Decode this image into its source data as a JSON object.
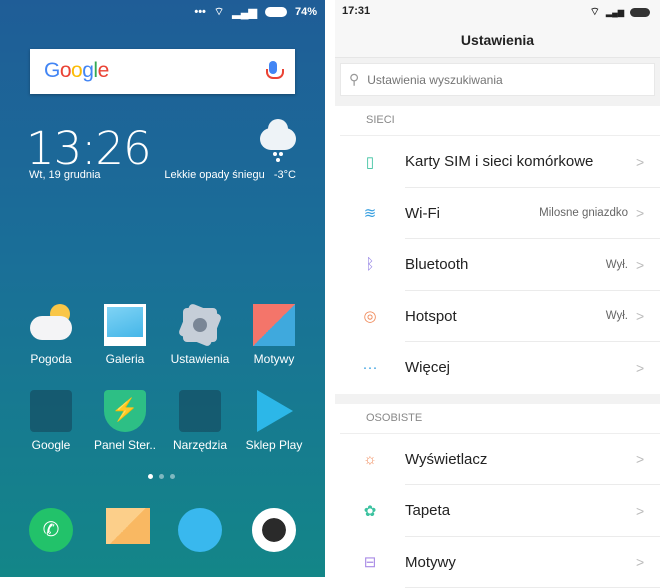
{
  "home": {
    "status": {
      "battery": "74%"
    },
    "search": {
      "logo": "Google",
      "mic_icon": "microphone-icon"
    },
    "clock": {
      "time": "13:26",
      "date": "Wt, 19 grudnia"
    },
    "weather": {
      "description": "Lekkie opady śniegu",
      "temperature": "-3°C",
      "icon": "snow-cloud-icon"
    },
    "apps": [
      {
        "label": "Pogoda"
      },
      {
        "label": "Galeria"
      },
      {
        "label": "Ustawienia"
      },
      {
        "label": "Motywy"
      },
      {
        "label": "Google"
      },
      {
        "label": "Panel Ster.."
      },
      {
        "label": "Narzędzia"
      },
      {
        "label": "Sklep Play"
      }
    ],
    "page_indicator": {
      "current": 1,
      "total": 3
    },
    "dock": [
      "phone-icon",
      "messages-icon",
      "browser-icon",
      "camera-icon"
    ]
  },
  "settings": {
    "status": {
      "time": "17:31"
    },
    "title": "Ustawienia",
    "search_placeholder": "Ustawienia wyszukiwania",
    "sections": [
      {
        "header": "SIECI",
        "items": [
          {
            "label": "Karty SIM i sieci komórkowe",
            "value": "",
            "icon": "sim-icon",
            "color": "#3cc2a0"
          },
          {
            "label": "Wi-Fi",
            "value": "Milosne gniazdko",
            "icon": "wifi-icon",
            "color": "#3aa0e0"
          },
          {
            "label": "Bluetooth",
            "value": "Wył.",
            "icon": "bluetooth-icon",
            "color": "#9b8be6"
          },
          {
            "label": "Hotspot",
            "value": "Wył.",
            "icon": "hotspot-icon",
            "color": "#f08a5a"
          },
          {
            "label": "Więcej",
            "value": "",
            "icon": "more-icon",
            "color": "#3aa0e0"
          }
        ]
      },
      {
        "header": "OSOBISTE",
        "items": [
          {
            "label": "Wyświetlacz",
            "value": "",
            "icon": "display-icon",
            "color": "#f08a5a"
          },
          {
            "label": "Tapeta",
            "value": "",
            "icon": "wallpaper-icon",
            "color": "#3cc2a0"
          },
          {
            "label": "Motywy",
            "value": "",
            "icon": "themes-icon",
            "color": "#a98be6"
          }
        ]
      }
    ]
  }
}
